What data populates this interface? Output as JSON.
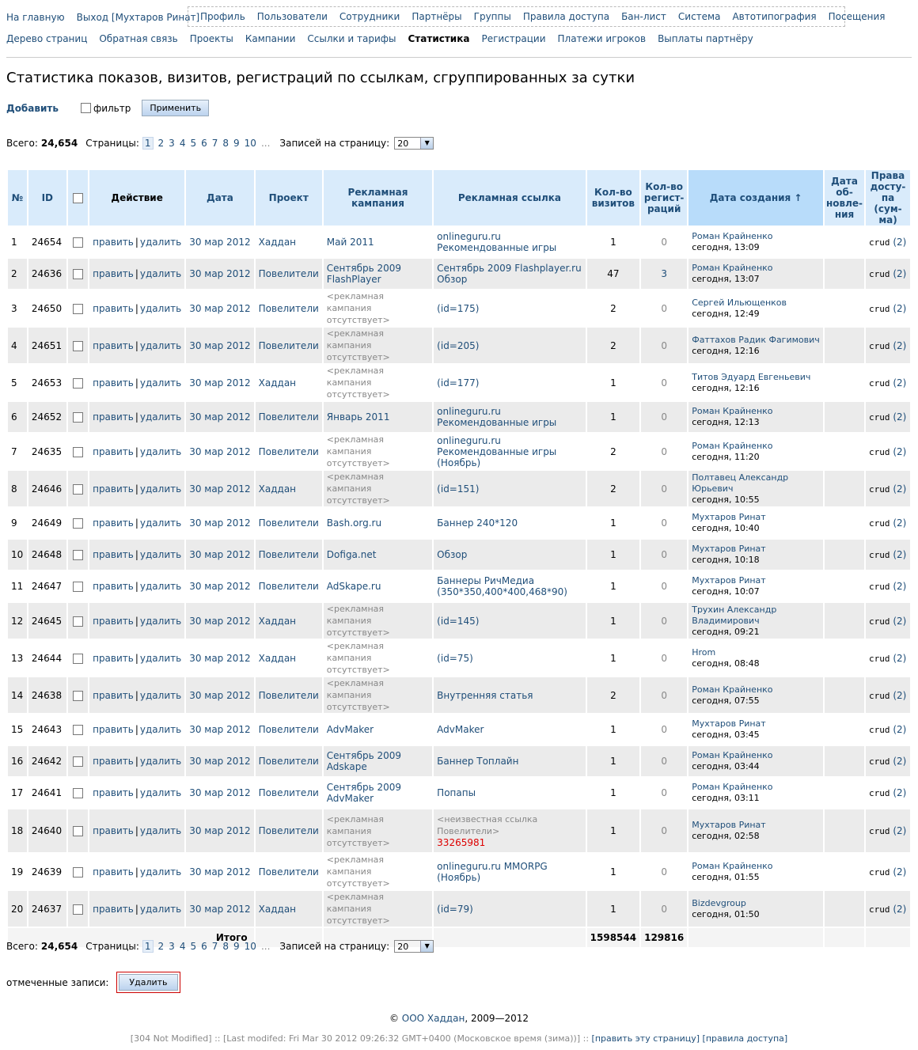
{
  "nav": {
    "home": "На главную",
    "logout": "Выход [Мухтаров Ринат]",
    "box": [
      "Профиль",
      "Пользователи",
      "Сотрудники",
      "Партнёры",
      "Группы",
      "Правила доступа",
      "Бан-лист",
      "Система",
      "Автотипография",
      "Посещения"
    ],
    "row2": [
      "Дерево страниц",
      "Обратная связь",
      "Проекты",
      "Кампании",
      "Ссылки и тарифы",
      "Статистика",
      "Регистрации",
      "Платежи игроков",
      "Выплаты партнёру"
    ],
    "active": "Статистика"
  },
  "page_title": "Статистика показов, визитов, регистраций по ссылкам, сгруппированных за сутки",
  "toolbar": {
    "add": "Добавить",
    "filter": "фильтр",
    "apply": "Применить"
  },
  "pager": {
    "total_label": "Всего:",
    "total_value": "24,654",
    "pages_label": "Страницы:",
    "pages": [
      "1",
      "2",
      "3",
      "4",
      "5",
      "6",
      "7",
      "8",
      "9",
      "10"
    ],
    "ellipsis": "...",
    "per_page_label": "Записей на страницу:",
    "per_page_value": "20"
  },
  "table": {
    "headers": {
      "num": "№",
      "id": "ID",
      "action": "Действие",
      "date": "Дата",
      "project": "Проект",
      "campaign": "Рекламная кампания",
      "link": "Рекламная ссылка",
      "visits": "Кол-во визитов",
      "regs": "Кол-во регист-раций",
      "created": "Дата создания ↑",
      "updated": "Дата об-новле-ния",
      "rights": "Права досту-па (сум-ма)"
    },
    "edit": "править",
    "sep": "|",
    "delete": "удалить",
    "rows": [
      {
        "n": "1",
        "id": "24654",
        "date": "30 мар 2012",
        "project": "Хаддан",
        "campaign": "Май 2011",
        "campaign_muted": false,
        "link": "onlineguru.ru Рекомендованные игры",
        "link_extra": "",
        "visits": "1",
        "regs": "0",
        "author": "Роман Крайненко",
        "time": "сегодня, 13:09",
        "rights": "crud",
        "rights_n": "(2)"
      },
      {
        "n": "2",
        "id": "24636",
        "date": "30 мар 2012",
        "project": "Повелители",
        "campaign": "Сентябрь 2009 FlashPlayer",
        "campaign_muted": false,
        "link": "Сентябрь 2009 Flashplayer.ru Обзор",
        "link_extra": "",
        "visits": "47",
        "regs": "3",
        "author": "Роман Крайненко",
        "time": "сегодня, 13:07",
        "rights": "crud",
        "rights_n": "(2)"
      },
      {
        "n": "3",
        "id": "24650",
        "date": "30 мар 2012",
        "project": "Повелители",
        "campaign": "<рекламная кампания отсутствует>",
        "campaign_muted": true,
        "link": "(id=175)",
        "link_extra": "",
        "visits": "2",
        "regs": "0",
        "author": "Сергей Ильющенков",
        "time": "сегодня, 12:49",
        "rights": "crud",
        "rights_n": "(2)"
      },
      {
        "n": "4",
        "id": "24651",
        "date": "30 мар 2012",
        "project": "Повелители",
        "campaign": "<рекламная кампания отсутствует>",
        "campaign_muted": true,
        "link": "(id=205)",
        "link_extra": "",
        "visits": "2",
        "regs": "0",
        "author": "Фаттахов Радик Фагимович",
        "time": "сегодня, 12:16",
        "rights": "crud",
        "rights_n": "(2)"
      },
      {
        "n": "5",
        "id": "24653",
        "date": "30 мар 2012",
        "project": "Хаддан",
        "campaign": "<рекламная кампания отсутствует>",
        "campaign_muted": true,
        "link": "(id=177)",
        "link_extra": "",
        "visits": "1",
        "regs": "0",
        "author": "Титов Эдуард Евгеньевич",
        "time": "сегодня, 12:16",
        "rights": "crud",
        "rights_n": "(2)"
      },
      {
        "n": "6",
        "id": "24652",
        "date": "30 мар 2012",
        "project": "Повелители",
        "campaign": "Январь 2011",
        "campaign_muted": false,
        "link": "onlineguru.ru Рекомендованные игры",
        "link_extra": "",
        "visits": "1",
        "regs": "0",
        "author": "Роман Крайненко",
        "time": "сегодня, 12:13",
        "rights": "crud",
        "rights_n": "(2)"
      },
      {
        "n": "7",
        "id": "24635",
        "date": "30 мар 2012",
        "project": "Повелители",
        "campaign": "<рекламная кампания отсутствует>",
        "campaign_muted": true,
        "link": "onlineguru.ru Рекомендованные игры (Ноябрь)",
        "link_extra": "",
        "visits": "2",
        "regs": "0",
        "author": "Роман Крайненко",
        "time": "сегодня, 11:20",
        "rights": "crud",
        "rights_n": "(2)"
      },
      {
        "n": "8",
        "id": "24646",
        "date": "30 мар 2012",
        "project": "Хаддан",
        "campaign": "<рекламная кампания отсутствует>",
        "campaign_muted": true,
        "link": "(id=151)",
        "link_extra": "",
        "visits": "2",
        "regs": "0",
        "author": "Полтавец Александр Юрьевич",
        "time": "сегодня, 10:55",
        "rights": "crud",
        "rights_n": "(2)"
      },
      {
        "n": "9",
        "id": "24649",
        "date": "30 мар 2012",
        "project": "Повелители",
        "campaign": "Bash.org.ru",
        "campaign_muted": false,
        "link": "Баннер 240*120",
        "link_extra": "",
        "visits": "1",
        "regs": "0",
        "author": "Мухтаров Ринат",
        "time": "сегодня, 10:40",
        "rights": "crud",
        "rights_n": "(2)"
      },
      {
        "n": "10",
        "id": "24648",
        "date": "30 мар 2012",
        "project": "Повелители",
        "campaign": "Dofiga.net",
        "campaign_muted": false,
        "link": "Обзор",
        "link_extra": "",
        "visits": "1",
        "regs": "0",
        "author": "Мухтаров Ринат",
        "time": "сегодня, 10:18",
        "rights": "crud",
        "rights_n": "(2)"
      },
      {
        "n": "11",
        "id": "24647",
        "date": "30 мар 2012",
        "project": "Повелители",
        "campaign": "AdSkape.ru",
        "campaign_muted": false,
        "link": "Баннеры РичМедиа (350*350,400*400,468*90)",
        "link_extra": "",
        "visits": "1",
        "regs": "0",
        "author": "Мухтаров Ринат",
        "time": "сегодня, 10:07",
        "rights": "crud",
        "rights_n": "(2)"
      },
      {
        "n": "12",
        "id": "24645",
        "date": "30 мар 2012",
        "project": "Хаддан",
        "campaign": "<рекламная кампания отсутствует>",
        "campaign_muted": true,
        "link": "(id=145)",
        "link_extra": "",
        "visits": "1",
        "regs": "0",
        "author": "Трухин Александр Владимирович",
        "time": "сегодня, 09:21",
        "rights": "crud",
        "rights_n": "(2)"
      },
      {
        "n": "13",
        "id": "24644",
        "date": "30 мар 2012",
        "project": "Хаддан",
        "campaign": "<рекламная кампания отсутствует>",
        "campaign_muted": true,
        "link": "(id=75)",
        "link_extra": "",
        "visits": "1",
        "regs": "0",
        "author": "Hrom",
        "time": "сегодня, 08:48",
        "rights": "crud",
        "rights_n": "(2)"
      },
      {
        "n": "14",
        "id": "24638",
        "date": "30 мар 2012",
        "project": "Повелители",
        "campaign": "<рекламная кампания отсутствует>",
        "campaign_muted": true,
        "link": "Внутренняя статья",
        "link_extra": "",
        "visits": "2",
        "regs": "0",
        "author": "Роман Крайненко",
        "time": "сегодня, 07:55",
        "rights": "crud",
        "rights_n": "(2)"
      },
      {
        "n": "15",
        "id": "24643",
        "date": "30 мар 2012",
        "project": "Повелители",
        "campaign": "AdvMaker",
        "campaign_muted": false,
        "link": "AdvMaker",
        "link_extra": "",
        "visits": "1",
        "regs": "0",
        "author": "Мухтаров Ринат",
        "time": "сегодня, 03:45",
        "rights": "crud",
        "rights_n": "(2)"
      },
      {
        "n": "16",
        "id": "24642",
        "date": "30 мар 2012",
        "project": "Повелители",
        "campaign": "Сентябрь 2009 Adskape",
        "campaign_muted": false,
        "link": "Баннер Топлайн",
        "link_extra": "",
        "visits": "1",
        "regs": "0",
        "author": "Роман Крайненко",
        "time": "сегодня, 03:44",
        "rights": "crud",
        "rights_n": "(2)"
      },
      {
        "n": "17",
        "id": "24641",
        "date": "30 мар 2012",
        "project": "Повелители",
        "campaign": "Сентябрь 2009 AdvMaker",
        "campaign_muted": false,
        "link": "Попапы",
        "link_extra": "",
        "visits": "1",
        "regs": "0",
        "author": "Роман Крайненко",
        "time": "сегодня, 03:11",
        "rights": "crud",
        "rights_n": "(2)"
      },
      {
        "n": "18",
        "id": "24640",
        "date": "30 мар 2012",
        "project": "Повелители",
        "campaign": "<рекламная кампания отсутствует>",
        "campaign_muted": true,
        "link": "<неизвестная ссылка Повелители>",
        "link_extra": "33265981",
        "visits": "1",
        "regs": "0",
        "author": "Мухтаров Ринат",
        "time": "сегодня, 02:58",
        "rights": "crud",
        "rights_n": "(2)"
      },
      {
        "n": "19",
        "id": "24639",
        "date": "30 мар 2012",
        "project": "Повелители",
        "campaign": "<рекламная кампания отсутствует>",
        "campaign_muted": true,
        "link": "onlineguru.ru MMORPG (Ноябрь)",
        "link_extra": "",
        "visits": "1",
        "regs": "0",
        "author": "Роман Крайненко",
        "time": "сегодня, 01:55",
        "rights": "crud",
        "rights_n": "(2)"
      },
      {
        "n": "20",
        "id": "24637",
        "date": "30 мар 2012",
        "project": "Хаддан",
        "campaign": "<рекламная кампания отсутствует>",
        "campaign_muted": true,
        "link": "(id=79)",
        "link_extra": "",
        "visits": "1",
        "regs": "0",
        "author": "Bizdevgroup",
        "time": "сегодня, 01:50",
        "rights": "crud",
        "rights_n": "(2)"
      }
    ],
    "total_label": "Итого",
    "total_visits": "1598544",
    "total_regs": "129816"
  },
  "marked": {
    "label": "отмеченные записи:",
    "delete": "Удалить"
  },
  "footer": {
    "copy": "©",
    "company": "ООО Хаддан",
    "years": ", 2009—2012",
    "status": "[304 Not Modified] :: [Last modifed: Fri Mar 30 2012 09:26:32 GMT+0400 (Московское время (зима))] ::",
    "edit_page": "[править эту страницу]",
    "access_rules": "[правила доступа]"
  }
}
